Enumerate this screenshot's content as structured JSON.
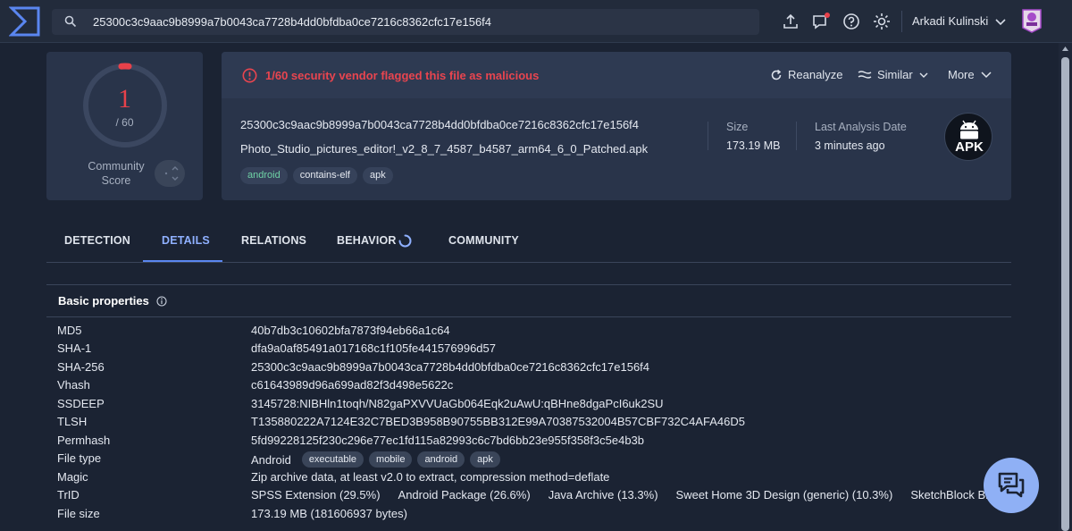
{
  "topbar": {
    "search_value": "25300c3c9aac9b8999a7b0043ca7728b4dd0bfdba0ce7216c8362cfc17e156f4",
    "user_name": "Arkadi Kulinski"
  },
  "score": {
    "detections": "1",
    "total": "/ 60",
    "detection_fraction": 0.0167,
    "community_label_line1": "Community",
    "community_label_line2": "Score"
  },
  "file": {
    "alert": "1/60 security vendor flagged this file as malicious",
    "actions": {
      "reanalyze": "Reanalyze",
      "similar": "Similar",
      "more": "More"
    },
    "hash": "25300c3c9aac9b8999a7b0043ca7728b4dd0bfdba0ce7216c8362cfc17e156f4",
    "name": "Photo_Studio_pictures_editor!_v2_8_7_4587_b4587_arm64_6_0_Patched.apk",
    "tags": [
      "android",
      "contains-elf",
      "apk"
    ],
    "size_label": "Size",
    "size_value": "173.19 MB",
    "analysis_label": "Last Analysis Date",
    "analysis_value": "3 minutes ago",
    "type_badge": "APK"
  },
  "tabs": {
    "detection": "DETECTION",
    "details": "DETAILS",
    "relations": "RELATIONS",
    "behavior": "BEHAVIOR",
    "community": "COMMUNITY"
  },
  "properties": {
    "title": "Basic properties",
    "rows": {
      "md5": {
        "key": "MD5",
        "value": "40b7db3c10602bfa7873f94eb66a1c64"
      },
      "sha1": {
        "key": "SHA-1",
        "value": "dfa9a0af85491a017168c1f105fe441576996d57"
      },
      "sha256": {
        "key": "SHA-256",
        "value": "25300c3c9aac9b8999a7b0043ca7728b4dd0bfdba0ce7216c8362cfc17e156f4"
      },
      "vhash": {
        "key": "Vhash",
        "value": "c61643989d96a699ad82f3d498e5622c"
      },
      "ssdeep": {
        "key": "SSDEEP",
        "value": "3145728:NIBHln1toqh/N82gaPXVVUaGb064Eqk2uAwU:qBHne8dgaPcI6uk2SU"
      },
      "tlsh": {
        "key": "TLSH",
        "value": "T135880222A7124E32C7BED3B958B90755BB312E99A70387532004B57CBF732C4AFA46D5"
      },
      "permhash": {
        "key": "Permhash",
        "value": "5fd99228125f230c296e77ec1fd115a82993c6c7bd6bb23e955f358f3c5e4b3b"
      },
      "filetype": {
        "key": "File type",
        "value": "Android",
        "tags": [
          "executable",
          "mobile",
          "android",
          "apk"
        ]
      },
      "magic": {
        "key": "Magic",
        "value": "Zip archive data, at least v2.0 to extract, compression method=deflate"
      },
      "trid": {
        "key": "TrID",
        "items": [
          "SPSS Extension (29.5%)",
          "Android Package (26.6%)",
          "Java Archive (13.3%)",
          "Sweet Home 3D Design (generic) (10.3%)",
          "SketchBlock Brush (8"
        ]
      },
      "filesize": {
        "key": "File size",
        "value": "173.19 MB (181606937 bytes)"
      }
    }
  },
  "colors": {
    "background": "#1b2333",
    "card": "#29344a",
    "danger": "#e8414a",
    "accent": "#8fb0ff",
    "chat_button": "#8fb0f5"
  }
}
